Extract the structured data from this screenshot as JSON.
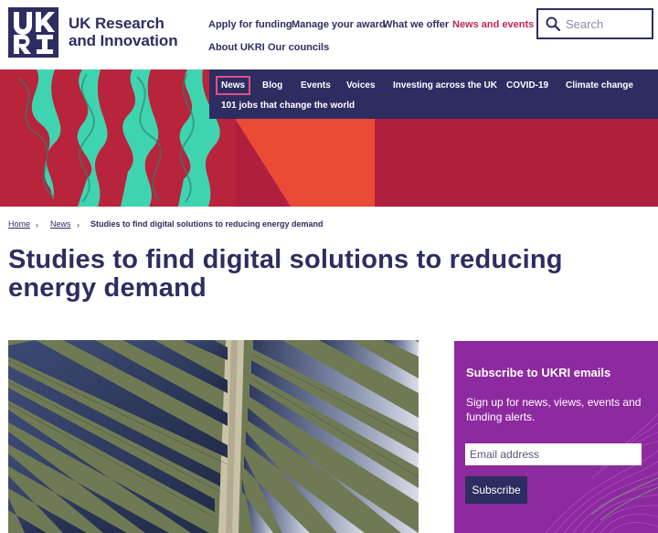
{
  "brand": {
    "logo_line1": "UK Research",
    "logo_line2": "and Innovation",
    "logo_mark": "UKRI logo",
    "color_primary": "#2e2d62",
    "color_accent": "#c0245f"
  },
  "topnav": {
    "items": [
      {
        "label": "Apply for funding"
      },
      {
        "label": "Manage your award"
      },
      {
        "label": "What we offer"
      },
      {
        "label": "News and events",
        "active": true
      },
      {
        "label": "About UKRI"
      },
      {
        "label": "Our councils"
      }
    ]
  },
  "search": {
    "placeholder": "Search",
    "icon": "search-icon"
  },
  "subnav": {
    "items": [
      {
        "label": "News",
        "current": true
      },
      {
        "label": "Blog"
      },
      {
        "label": "Events"
      },
      {
        "label": "Voices"
      },
      {
        "label": "Investing across the UK"
      },
      {
        "label": "COVID-19"
      },
      {
        "label": "Climate change"
      },
      {
        "label": "101 jobs that change the world"
      }
    ]
  },
  "breadcrumb": {
    "home": "Home",
    "section": "News",
    "current": "Studies to find digital solutions to reducing energy demand",
    "separator": "›"
  },
  "page": {
    "title": "Studies to find digital solutions to reducing energy demand"
  },
  "subscribe": {
    "title": "Subscribe to UKRI emails",
    "description": "Sign up for news, views, events and funding alerts.",
    "email_placeholder": "Email address",
    "button_label": "Subscribe",
    "background_color": "#8e2a9f"
  }
}
